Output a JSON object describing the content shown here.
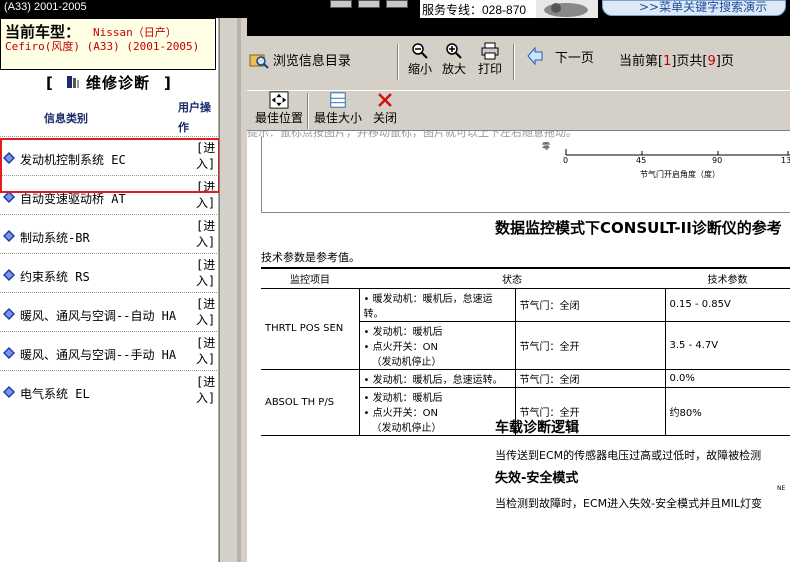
{
  "top": {
    "model_years": "(A33) 2001-2005",
    "service_hotline": "服务专线：028-870",
    "keyword_search_demo": ">>菜单关键字搜索演示"
  },
  "left": {
    "model_label": "当前车型：",
    "model_value_line1": "Nissan（日产）",
    "model_value_line2": "Cefiro(风度) (A33) (2001-2005)",
    "section_title": "维修诊断",
    "col_category": "信息类别",
    "col_user_action": "用户操作",
    "items": [
      {
        "name": "发动机控制系统 EC",
        "action": "[进入]"
      },
      {
        "name": "自动变速驱动桥 AT",
        "action": "[进入]"
      },
      {
        "name": "制动系统-BR",
        "action": "[进入]"
      },
      {
        "name": "约束系统 RS",
        "action": "[进入]"
      },
      {
        "name": "暖风、通风与空调--自动 HA",
        "action": "[进入]"
      },
      {
        "name": "暖风、通风与空调--手动 HA",
        "action": "[进入]"
      },
      {
        "name": "电气系统 EL",
        "action": "[进入]"
      }
    ]
  },
  "viewer": {
    "browse_toc": "浏览信息目录",
    "zoom_out": "缩小",
    "zoom_in": "放大",
    "print": "打印",
    "next_page": "下一页",
    "page_prefix": "当前第[",
    "page_current": "1",
    "page_mid": "]页共[",
    "page_total": "9",
    "page_suffix": "]页",
    "best_position": "最佳位置",
    "best_size": "最佳大小",
    "close": "关闭"
  },
  "doc": {
    "hint_partial": "提示：鼠标点按图片，并移动鼠标，图片就可以上下左右随意拖动。",
    "axis_ticks": [
      "0",
      "45",
      "90",
      "13"
    ],
    "axis_label": "节气门开启角度（度）",
    "axis_y_char": "零",
    "title": "数据监控模式下CONSULT-II诊断仪的参考",
    "note": "技术参数是参考值。",
    "table_headers": [
      "监控项目",
      "状态",
      "技术参数"
    ],
    "rows": [
      {
        "item": "THRTL POS SEN",
        "cond1": [
          "• 暖发动机：暖机后，怠速运转。"
        ],
        "state1": "节气门：全闭",
        "value1": "0.15 - 0.85V",
        "cond2": [
          "• 发动机：暖机后",
          "• 点火开关：ON",
          "（发动机停止）"
        ],
        "state2": "节气门：全开",
        "value2": "3.5 - 4.7V"
      },
      {
        "item": "ABSOL TH P/S",
        "cond1": [
          "• 发动机：暖机后，怠速运转。"
        ],
        "state1": "节气门：全闭",
        "value1": "0.0%",
        "cond2": [
          "• 发动机：暖机后",
          "• 点火开关：ON",
          "（发动机停止）"
        ],
        "state2": "节气门：全开",
        "value2": "约80%"
      }
    ],
    "section1_title": "车载诊断逻辑",
    "section1_text": "当传送到ECM的传感器电压过高或过低时，故障被检测",
    "section2_title": "失效-安全模式",
    "section2_text": "当检测到故障时，ECM进入失效-安全模式并且MIL灯变",
    "small_mark": "NE"
  }
}
